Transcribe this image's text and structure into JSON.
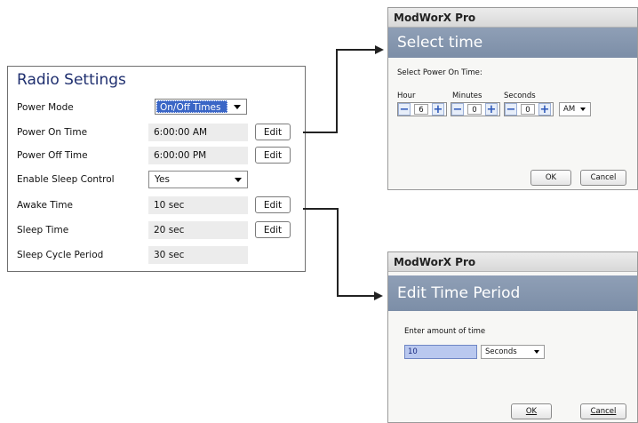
{
  "radio_settings": {
    "title": "Radio Settings",
    "rows": [
      {
        "label": "Power Mode",
        "value": "On/Off Times"
      },
      {
        "label": "Power On Time",
        "value": "6:00:00 AM",
        "button": "Edit"
      },
      {
        "label": "Power Off Time",
        "value": "6:00:00 PM",
        "button": "Edit"
      },
      {
        "label": "Enable Sleep Control",
        "value": "Yes"
      },
      {
        "label": "Awake Time",
        "value": "10 sec",
        "button": "Edit"
      },
      {
        "label": "Sleep Time",
        "value": "20 sec",
        "button": "Edit"
      },
      {
        "label": "Sleep Cycle Period",
        "value": "30 sec"
      }
    ]
  },
  "select_time_dialog": {
    "app_title": "ModWorX Pro",
    "banner": "Select time",
    "prompt": "Select Power On Time:",
    "hour_label": "Hour",
    "minutes_label": "Minutes",
    "seconds_label": "Seconds",
    "hour_value": "6",
    "minutes_value": "0",
    "seconds_value": "0",
    "ampm_value": "AM",
    "minus": "−",
    "plus": "+",
    "ok": "OK",
    "cancel": "Cancel"
  },
  "edit_period_dialog": {
    "app_title": "ModWorX Pro",
    "banner": "Edit Time Period",
    "prompt": "Enter amount of time",
    "amount_value": "10",
    "unit_value": "Seconds",
    "ok": "OK",
    "cancel": "Cancel"
  },
  "colors": {
    "panel_title": "#1f2f6f",
    "dialog_banner": "#7c8ea7",
    "selection_blue": "#3a66c6"
  },
  "icons": [
    "dropdown-arrow-icon",
    "minus-icon",
    "plus-icon",
    "arrow-right-icon"
  ]
}
